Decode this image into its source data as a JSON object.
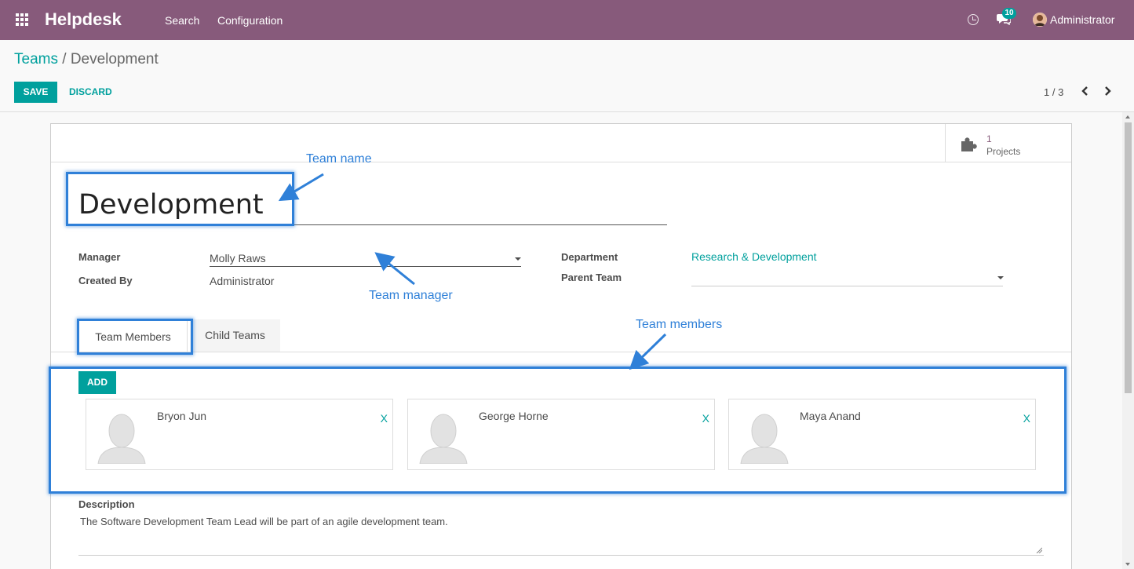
{
  "navbar": {
    "brand": "Helpdesk",
    "menu": [
      "Search",
      "Configuration"
    ],
    "notification_count": "10",
    "user": "Administrator"
  },
  "breadcrumb": {
    "parent": "Teams",
    "separator": " / ",
    "current": "Development"
  },
  "actions": {
    "save": "SAVE",
    "discard": "DISCARD"
  },
  "pager": {
    "value": "1 / 3"
  },
  "smart_button": {
    "count": "1",
    "label": "Projects"
  },
  "form": {
    "title": "Development",
    "manager_label": "Manager",
    "manager_value": "Molly Raws",
    "created_by_label": "Created By",
    "created_by_value": "Administrator",
    "department_label": "Department",
    "department_value": "Research & Development",
    "parent_team_label": "Parent Team",
    "parent_team_value": ""
  },
  "tabs": [
    {
      "label": "Team Members",
      "active": true
    },
    {
      "label": "Child Teams",
      "active": false
    }
  ],
  "members": {
    "add_label": "ADD",
    "remove_label": "X",
    "list": [
      {
        "name": "Bryon Jun"
      },
      {
        "name": "George Horne"
      },
      {
        "name": "Maya Anand"
      }
    ]
  },
  "description": {
    "label": "Description",
    "text": "The Software Development Team Lead will be part of an agile development team."
  },
  "annotations": {
    "team_name": "Team name",
    "team_manager": "Team manager",
    "team_members": "Team members"
  },
  "colors": {
    "navbar": "#875a7b",
    "primary": "#00a09d",
    "annotation": "#2f80d8"
  }
}
